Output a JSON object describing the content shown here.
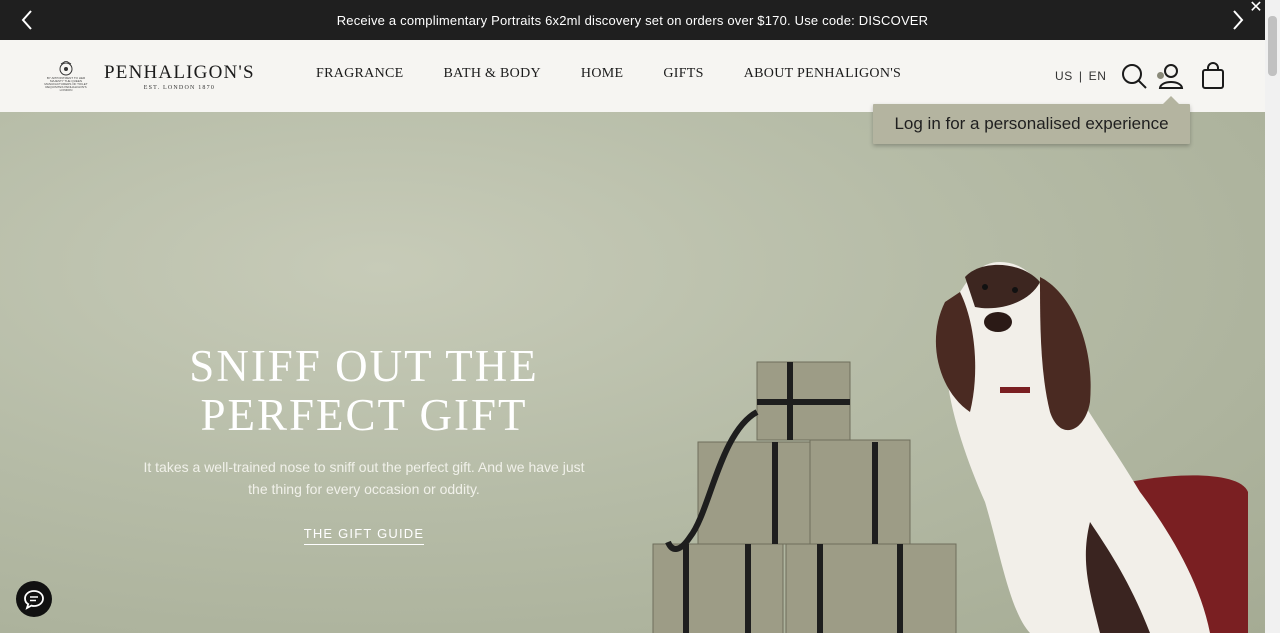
{
  "announcement": {
    "text": "Receive a complimentary Portraits 6x2ml discovery set on orders over $170. Use code: DISCOVER"
  },
  "brand": {
    "name": "PENHALIGON'S",
    "established": "EST. LONDON 1870",
    "crest_text": "BY APPOINTMENT TO HER MAJESTY THE QUEEN MANUFACTURERS OF TOILET REQUISITES PENHALIGON'S LONDON"
  },
  "nav": {
    "items": [
      "FRAGRANCE",
      "BATH & BODY",
      "HOME",
      "GIFTS",
      "ABOUT PENHALIGON'S"
    ]
  },
  "locale": {
    "country": "US",
    "separator": "|",
    "language": "EN"
  },
  "tooltip": {
    "text": "Log in for a personalised experience"
  },
  "hero": {
    "title_line1": "SNIFF OUT THE",
    "title_line2": "PERFECT GIFT",
    "subtitle": "It takes a well-trained nose to sniff out the perfect gift. And we have just the thing for every occasion or oddity.",
    "cta": "THE GIFT GUIDE"
  },
  "icons": [
    "chevron-left-icon",
    "chevron-right-icon",
    "close-icon",
    "search-icon",
    "account-icon",
    "bag-icon",
    "chat-icon"
  ],
  "colors": {
    "announcement_bg": "#1f1f1f",
    "header_bg": "#f6f5f2",
    "tooltip_bg": "#b4b4a0",
    "hero_bg": "#b6bca7"
  }
}
